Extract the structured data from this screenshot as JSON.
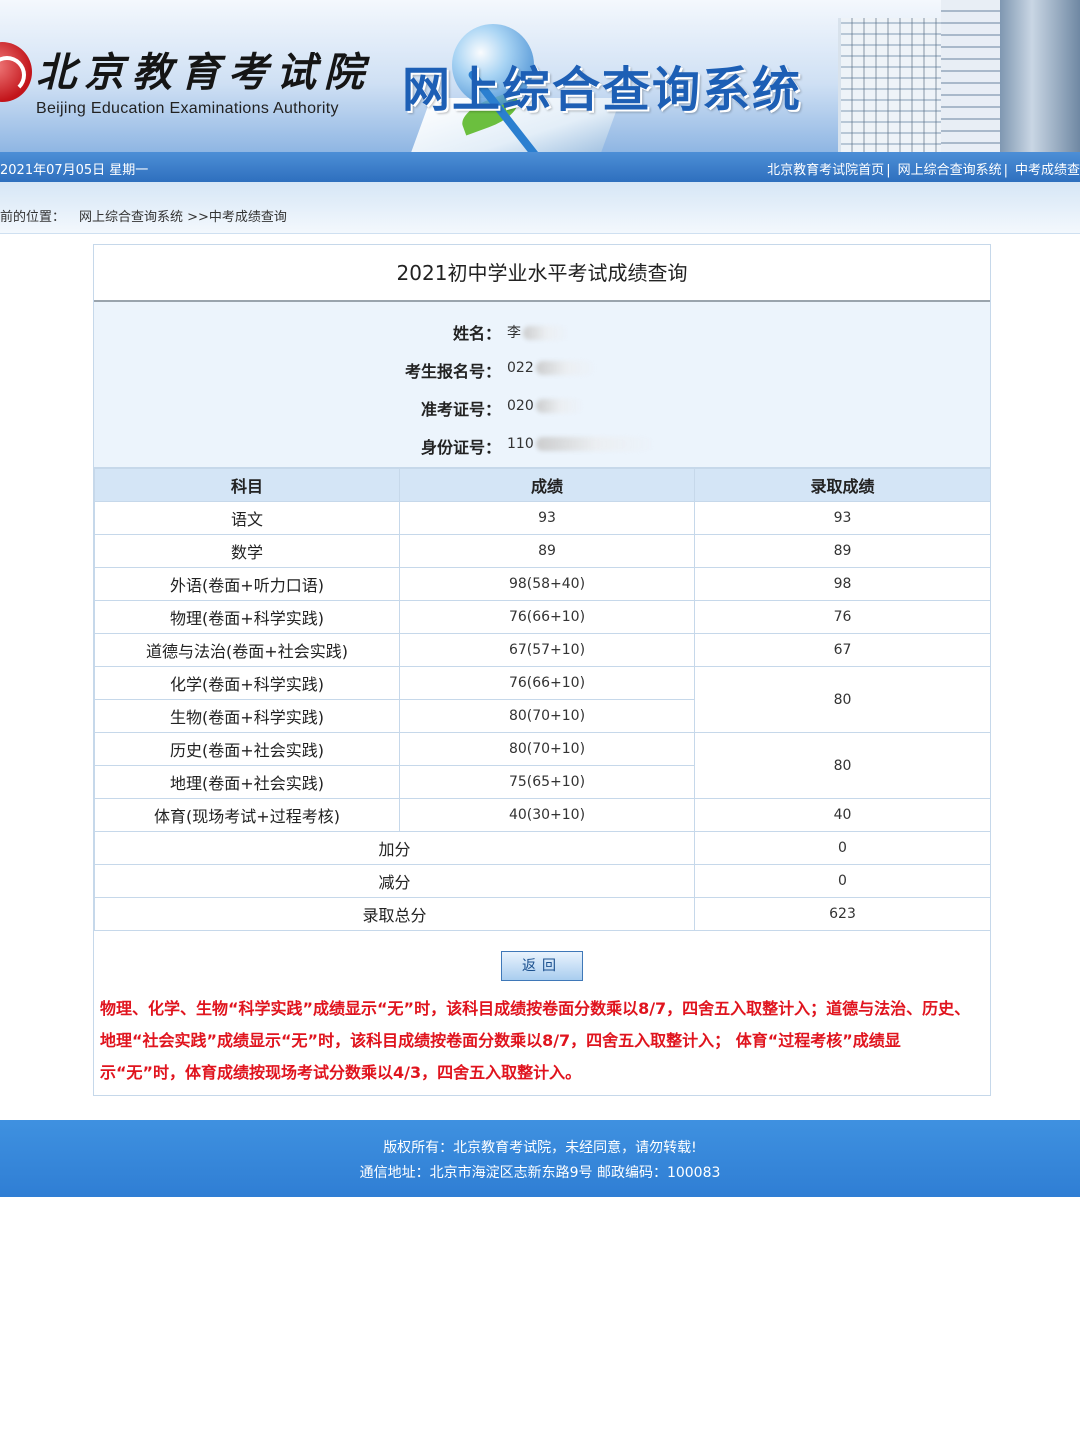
{
  "header": {
    "logo_cn": "北京教育考试院",
    "logo_en": "Beijing Education Examinations Authority",
    "system_title": "网上综合查询系统"
  },
  "navbar": {
    "date": "2021年07月05日 星期一",
    "links": [
      "北京教育考试院首页",
      "网上综合查询系统",
      "中考成绩查"
    ]
  },
  "breadcrumb": {
    "label": "前的位置：",
    "path": "网上综合查询系统 >>中考成绩查询"
  },
  "panel": {
    "title": "2021初中学业水平考试成绩查询"
  },
  "student": {
    "name_label": "姓名：",
    "name_value": "李",
    "reg_label": "考生报名号：",
    "reg_value": "022",
    "admit_label": "准考证号：",
    "admit_value": "020",
    "id_label": "身份证号：",
    "id_value": "110"
  },
  "table": {
    "headers": [
      "科目",
      "成绩",
      "录取成绩"
    ],
    "rows": [
      {
        "subject": "语文",
        "score": "93",
        "admit": "93"
      },
      {
        "subject": "数学",
        "score": "89",
        "admit": "89"
      },
      {
        "subject": "外语(卷面+听力口语)",
        "score": "98(58+40)",
        "admit": "98"
      },
      {
        "subject": "物理(卷面+科学实践)",
        "score": "76(66+10)",
        "admit": "76"
      },
      {
        "subject": "道德与法治(卷面+社会实践)",
        "score": "67(57+10)",
        "admit": "67"
      },
      {
        "subject": "化学(卷面+科学实践)",
        "score": "76(66+10)",
        "admit": "80"
      },
      {
        "subject": "生物(卷面+科学实践)",
        "score": "80(70+10)",
        "admit": ""
      },
      {
        "subject": "历史(卷面+社会实践)",
        "score": "80(70+10)",
        "admit": "80"
      },
      {
        "subject": "地理(卷面+社会实践)",
        "score": "75(65+10)",
        "admit": ""
      },
      {
        "subject": "体育(现场考试+过程考核)",
        "score": "40(30+10)",
        "admit": "40"
      }
    ],
    "bonus_label": "加分",
    "bonus_value": "0",
    "deduct_label": "减分",
    "deduct_value": "0",
    "total_label": "录取总分",
    "total_value": "623"
  },
  "actions": {
    "back_label": "返回"
  },
  "notice": "物理、化学、生物“科学实践”成绩显示“无”时，该科目成绩按卷面分数乘以8/7，四舍五入取整计入；道德与法治、历史、地理“社会实践”成绩显示“无”时，该科目成绩按卷面分数乘以8/7，四舍五入取整计入； 体育“过程考核”成绩显示“无”时，体育成绩按现场考试分数乘以4/3，四舍五入取整计入。",
  "footer": {
    "line1": "版权所有：北京教育考试院，未经同意，请勿转载!",
    "line2": "通信地址：北京市海淀区志新东路9号 邮政编码：100083"
  }
}
